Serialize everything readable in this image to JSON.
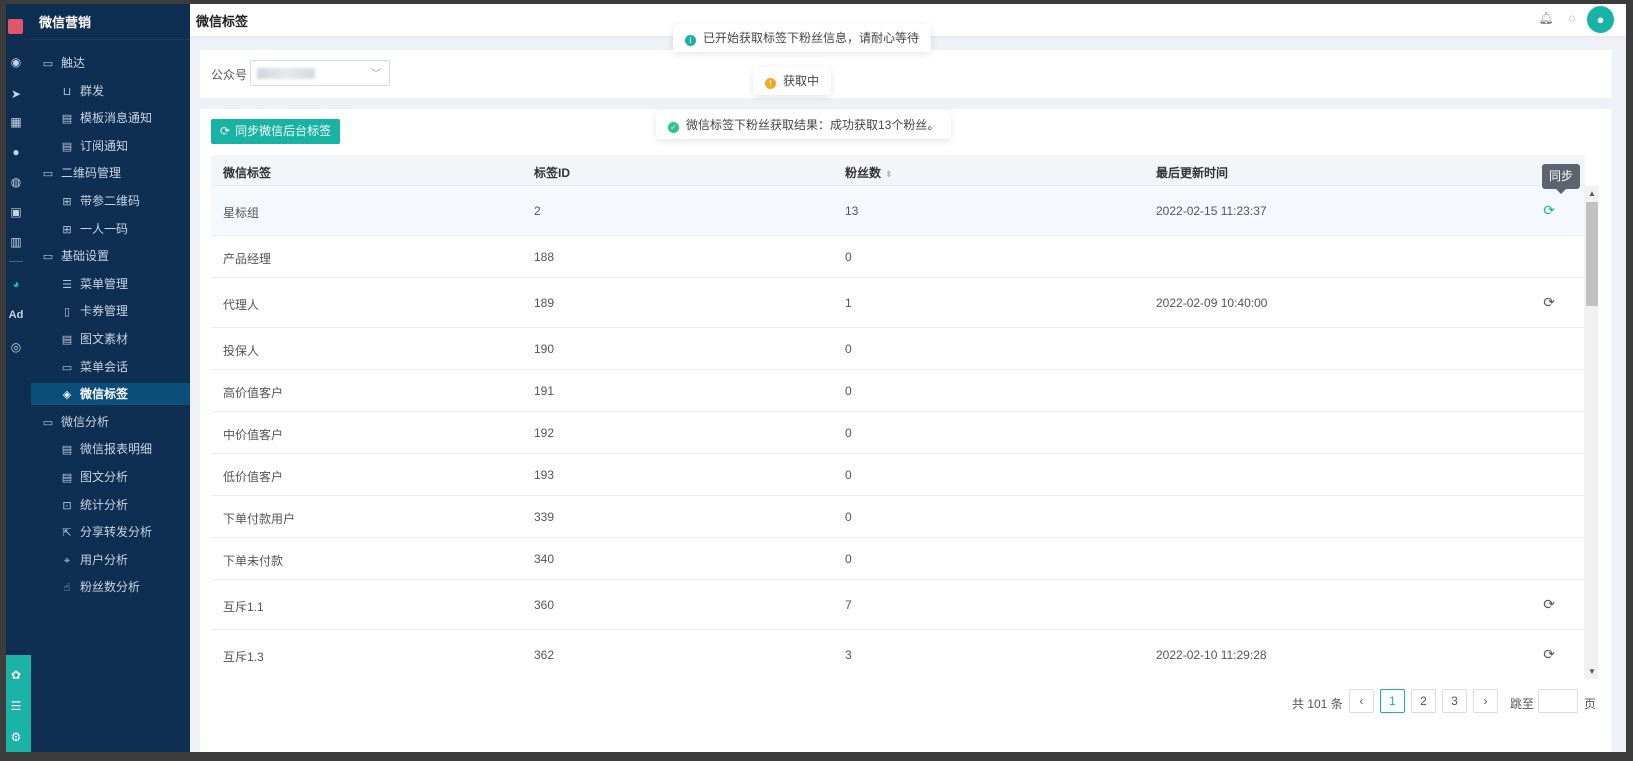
{
  "app": {
    "brand": "微信营销",
    "page_title": "微信标签"
  },
  "rail_icons": [
    "dashboard-icon",
    "send-icon",
    "calendar-icon",
    "user-icon",
    "users-icon",
    "bookmark-icon",
    "chart-icon",
    "wechat-icon",
    "ad-icon",
    "play-circle-icon",
    "team-icon",
    "server-icon",
    "gear-icon"
  ],
  "sidebar": {
    "items": [
      {
        "label": "触达",
        "type": "group",
        "icon": "folder-icon"
      },
      {
        "label": "群发",
        "type": "child",
        "icon": "broadcast-icon"
      },
      {
        "label": "模板消息通知",
        "type": "child",
        "icon": "template-icon"
      },
      {
        "label": "订阅通知",
        "type": "child",
        "icon": "subscribe-icon"
      },
      {
        "label": "二维码管理",
        "type": "group",
        "icon": "folder-icon"
      },
      {
        "label": "带参二维码",
        "type": "child",
        "icon": "qrcode-icon"
      },
      {
        "label": "一人一码",
        "type": "child",
        "icon": "qrcode-person-icon"
      },
      {
        "label": "基础设置",
        "type": "group",
        "icon": "folder-icon"
      },
      {
        "label": "菜单管理",
        "type": "child",
        "icon": "list-icon"
      },
      {
        "label": "卡券管理",
        "type": "child",
        "icon": "coupon-icon"
      },
      {
        "label": "图文素材",
        "type": "child",
        "icon": "article-icon"
      },
      {
        "label": "菜单会话",
        "type": "child",
        "icon": "chat-icon"
      },
      {
        "label": "微信标签",
        "type": "child",
        "icon": "tag-icon",
        "active": true
      },
      {
        "label": "微信分析",
        "type": "group",
        "icon": "folder-icon"
      },
      {
        "label": "微信报表明细",
        "type": "child",
        "icon": "report-icon"
      },
      {
        "label": "图文分析",
        "type": "child",
        "icon": "article-analysis-icon"
      },
      {
        "label": "统计分析",
        "type": "child",
        "icon": "stats-icon"
      },
      {
        "label": "分享转发分析",
        "type": "child",
        "icon": "share-icon"
      },
      {
        "label": "用户分析",
        "type": "child",
        "icon": "user-scan-icon"
      },
      {
        "label": "粉丝数分析",
        "type": "child",
        "icon": "thumb-icon"
      }
    ]
  },
  "filter": {
    "account_label": "公众号"
  },
  "toolbar": {
    "sync_label": "同步微信后台标签"
  },
  "table": {
    "columns": [
      "微信标签",
      "标签ID",
      "粉丝数",
      "最后更新时间"
    ],
    "rows": [
      {
        "name": "星标组",
        "id": "2",
        "fans": "13",
        "updated": "2022-02-15 11:23:37",
        "sync": true,
        "highlight": true
      },
      {
        "name": "产品经理",
        "id": "188",
        "fans": "0",
        "updated": "",
        "sync": false
      },
      {
        "name": "代理人",
        "id": "189",
        "fans": "1",
        "updated": "2022-02-09 10:40:00",
        "sync": true
      },
      {
        "name": "投保人",
        "id": "190",
        "fans": "0",
        "updated": "",
        "sync": false
      },
      {
        "name": "高价值客户",
        "id": "191",
        "fans": "0",
        "updated": "",
        "sync": false
      },
      {
        "name": "中价值客户",
        "id": "192",
        "fans": "0",
        "updated": "",
        "sync": false
      },
      {
        "name": "低价值客户",
        "id": "193",
        "fans": "0",
        "updated": "",
        "sync": false
      },
      {
        "name": "下单付款用户",
        "id": "339",
        "fans": "0",
        "updated": "",
        "sync": false
      },
      {
        "name": "下单未付款",
        "id": "340",
        "fans": "0",
        "updated": "",
        "sync": false
      },
      {
        "name": "互斥1.1",
        "id": "360",
        "fans": "7",
        "updated": "",
        "sync": true
      },
      {
        "name": "互斥1.3",
        "id": "362",
        "fans": "3",
        "updated": "2022-02-10 11:29:28",
        "sync": true
      }
    ],
    "tooltip": "同步"
  },
  "pagination": {
    "total_text": "共 101 条",
    "pages": [
      "1",
      "2",
      "3"
    ],
    "current": "1",
    "jump_label": "跳至",
    "page_suffix": "页"
  },
  "toasts": [
    {
      "text": "已开始获取标签下粉丝信息，请耐心等待",
      "type": "info",
      "color": "#17b3a4"
    },
    {
      "text": "获取中",
      "type": "warning",
      "color": "#f5a623"
    },
    {
      "text": "微信标签下粉丝获取结果：成功获取13个粉丝。",
      "type": "success",
      "color": "#2bc48a"
    }
  ]
}
